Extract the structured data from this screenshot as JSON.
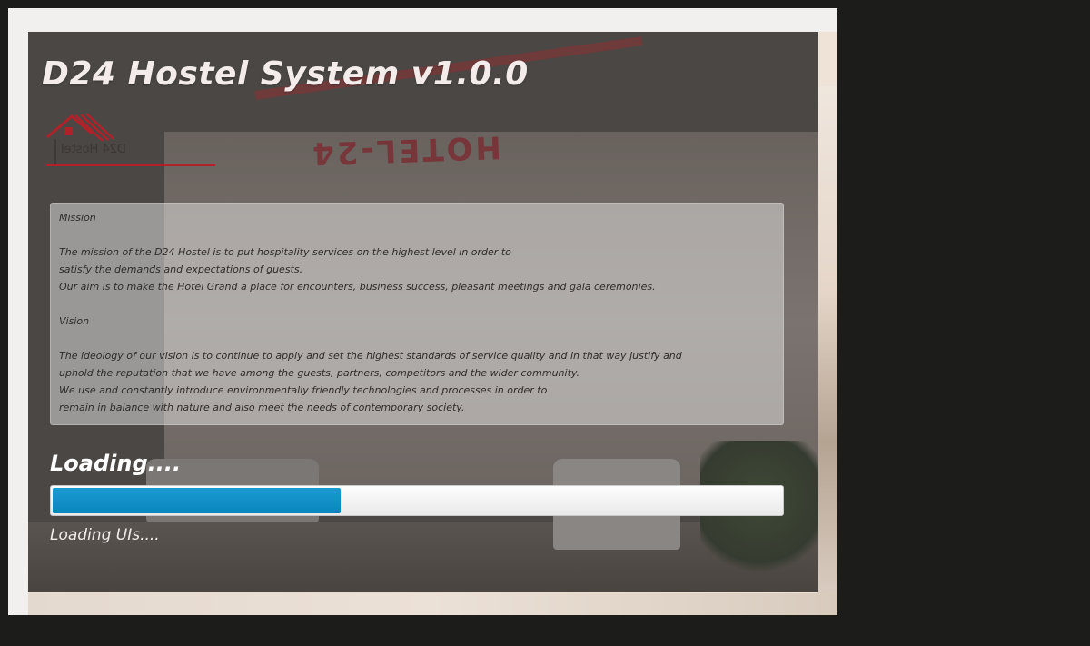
{
  "app": {
    "title": "D24 Hostel System v1.0.0"
  },
  "logo": {
    "text": "D24 Hostel",
    "icon": "house-icon",
    "accent": "#b0222a"
  },
  "background": {
    "sign_text": "HOTEL-24"
  },
  "mission": {
    "lines": [
      "Mission",
      "",
      "The mission of the D24 Hostel is to put hospitality services on the highest level in order to",
      "satisfy the demands and expectations of guests.",
      "Our aim is to make the Hotel Grand a place for encounters, business success, pleasant meetings and gala ceremonies.",
      "",
      "Vision",
      "",
      "The ideology of our vision is to continue to apply and set the highest standards of service quality and in that way justify and",
      "uphold the reputation that we have among the guests, partners, competitors and the wider community.",
      "We use and constantly introduce environmentally friendly technologies and processes in order to",
      "remain in balance with nature and also meet the needs of contemporary society."
    ]
  },
  "loading": {
    "title": "Loading....",
    "status": "Loading UIs....",
    "progress_fraction": 0.395,
    "bar_color": "#0a8fc7"
  }
}
